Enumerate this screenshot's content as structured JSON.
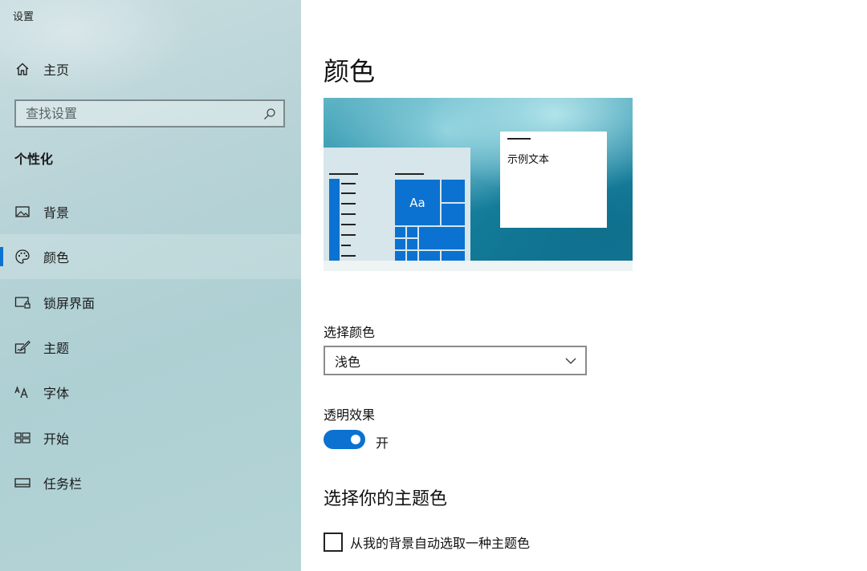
{
  "app": {
    "title": "设置"
  },
  "sidebar": {
    "home_label": "主页",
    "search": {
      "placeholder": "查找设置",
      "value": ""
    },
    "section_title": "个性化",
    "items": [
      {
        "label": "背景",
        "icon": "image-icon"
      },
      {
        "label": "颜色",
        "icon": "palette-icon",
        "active": true
      },
      {
        "label": "锁屏界面",
        "icon": "lock-screen-icon"
      },
      {
        "label": "主题",
        "icon": "theme-brush-icon"
      },
      {
        "label": "字体",
        "icon": "font-icon"
      },
      {
        "label": "开始",
        "icon": "start-icon"
      },
      {
        "label": "任务栏",
        "icon": "taskbar-icon"
      }
    ]
  },
  "main": {
    "title": "颜色",
    "preview": {
      "sample_text": "示例文本",
      "tile_label": "Aa"
    },
    "choose_color": {
      "label": "选择颜色",
      "selected": "浅色"
    },
    "transparency": {
      "label": "透明效果",
      "state_text": "开",
      "on": true
    },
    "accent": {
      "heading": "选择你的主题色",
      "auto_pick_label": "从我的背景自动选取一种主题色",
      "auto_pick_checked": false
    }
  },
  "colors": {
    "accent": "#0b72d1",
    "sidebar_bg": "#b7d3d7"
  }
}
